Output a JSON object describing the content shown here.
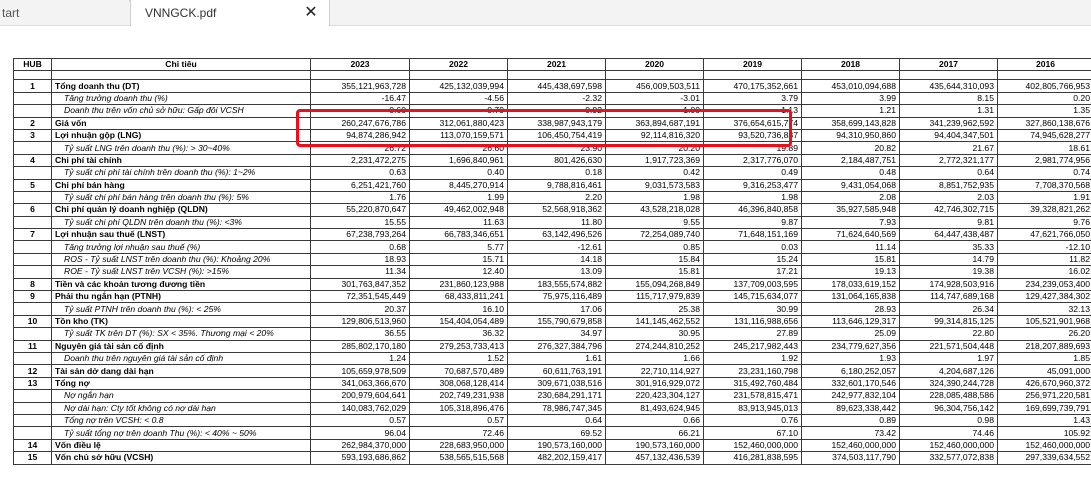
{
  "tabs": {
    "start_label": "tart",
    "file_label": "VNNGCK.pdf",
    "close_glyph": "✕"
  },
  "table": {
    "headers": [
      "HUB",
      "Chỉ tiêu",
      "2023",
      "2022",
      "2021",
      "2020",
      "2019",
      "2018",
      "2017",
      "2016"
    ],
    "rows": [
      {
        "hub": "1",
        "label": "Tổng doanh thu (DT)",
        "kind": "main",
        "values": [
          "355,121,963,728",
          "425,132,039,994",
          "445,438,697,598",
          "456,009,503,511",
          "470,175,352,661",
          "453,010,094,688",
          "435,644,310,093",
          "402,805,766,953"
        ]
      },
      {
        "hub": "",
        "label": "Tăng trưởng doanh thu (%)",
        "kind": "sub",
        "values": [
          "-16.47",
          "-4.56",
          "-2.32",
          "-3.01",
          "3.79",
          "3.99",
          "8.15",
          "0.20"
        ]
      },
      {
        "hub": "",
        "label": "Doanh thu trên vốn chủ sở hữu: Gấp đôi VCSH",
        "kind": "sub",
        "values": [
          "0.60",
          "0.79",
          "0.92",
          "1.00",
          "1.13",
          "1.21",
          "1.31",
          "1.35"
        ]
      },
      {
        "hub": "2",
        "label": "Giá vốn",
        "kind": "main",
        "values": [
          "260,247,676,786",
          "312,061,880,423",
          "338,987,943,179",
          "363,894,687,191",
          "376,654,615,774",
          "358,699,143,828",
          "341,239,962,592",
          "327,860,138,676"
        ]
      },
      {
        "hub": "3",
        "label": "Lợi nhuận gộp (LNG)",
        "kind": "main",
        "values": [
          "94,874,286,942",
          "113,070,159,571",
          "106,450,754,419",
          "92,114,816,320",
          "93,520,736,887",
          "94,310,950,860",
          "94,404,347,501",
          "74,945,628,277"
        ]
      },
      {
        "hub": "",
        "label": "Tỷ suất LNG trên doanh thu (%): > 30~40%",
        "kind": "sub",
        "values": [
          "26.72",
          "26.60",
          "23.90",
          "20.20",
          "19.89",
          "20.82",
          "21.67",
          "18.61"
        ]
      },
      {
        "hub": "4",
        "label": "Chi phí tài chính",
        "kind": "main",
        "values": [
          "2,231,472,275",
          "1,696,840,961",
          "801,426,630",
          "1,917,723,369",
          "2,317,776,070",
          "2,184,487,751",
          "2,772,321,177",
          "2,981,774,956"
        ]
      },
      {
        "hub": "",
        "label": "Tỷ suất chi phí tài chính trên doanh thu (%): 1~2%",
        "kind": "sub",
        "values": [
          "0.63",
          "0.40",
          "0.18",
          "0.42",
          "0.49",
          "0.48",
          "0.64",
          "0.74"
        ]
      },
      {
        "hub": "5",
        "label": "Chi phí bán hàng",
        "kind": "main",
        "values": [
          "6,251,421,760",
          "8,445,270,914",
          "9,788,816,461",
          "9,031,573,583",
          "9,316,253,477",
          "9,431,054,068",
          "8,851,752,935",
          "7,708,370,568"
        ]
      },
      {
        "hub": "",
        "label": "Tỷ suất chi phí bán hàng trên doanh thu (%): 5%",
        "kind": "sub",
        "values": [
          "1.76",
          "1.99",
          "2.20",
          "1.98",
          "1.98",
          "2.08",
          "2.03",
          "1.91"
        ]
      },
      {
        "hub": "6",
        "label": "Chi phí quản lý doanh nghiệp (QLDN)",
        "kind": "main",
        "values": [
          "55,220,870,647",
          "49,462,002,948",
          "52,568,918,362",
          "43,528,218,028",
          "46,396,840,858",
          "35,927,585,948",
          "42,746,302,715",
          "39,328,821,262"
        ]
      },
      {
        "hub": "",
        "label": "Tỷ suất chi phí QLDN trên doanh thu (%): <3%",
        "kind": "sub",
        "values": [
          "15.55",
          "11.63",
          "11.80",
          "9.55",
          "9.87",
          "7.93",
          "9.81",
          "9.76"
        ]
      },
      {
        "hub": "7",
        "label": "Lợi nhuận sau thuế (LNST)",
        "kind": "main",
        "values": [
          "67,238,793,264",
          "66,783,346,651",
          "63,142,496,526",
          "72,254,089,740",
          "71,648,151,169",
          "71,624,640,569",
          "64,447,438,487",
          "47,621,766,050"
        ]
      },
      {
        "hub": "",
        "label": "Tăng trưởng lợi nhuận sau thuế (%)",
        "kind": "sub",
        "values": [
          "0.68",
          "5.77",
          "-12.61",
          "0.85",
          "0.03",
          "11.14",
          "35.33",
          "-12.10"
        ]
      },
      {
        "hub": "",
        "label": "ROS - Tỷ suất LNST trên doanh thu (%): Khoảng 20%",
        "kind": "sub",
        "values": [
          "18.93",
          "15.71",
          "14.18",
          "15.84",
          "15.24",
          "15.81",
          "14.79",
          "11.82"
        ]
      },
      {
        "hub": "",
        "label": "ROE - Tỷ suất LNST trên VCSH (%): >15%",
        "kind": "sub",
        "values": [
          "11.34",
          "12.40",
          "13.09",
          "15.81",
          "17.21",
          "19.13",
          "19.38",
          "16.02"
        ]
      },
      {
        "hub": "8",
        "label": "Tiền và các khoản tương đương tiền",
        "kind": "main",
        "values": [
          "301,763,847,352",
          "231,860,123,988",
          "183,555,574,882",
          "155,094,268,849",
          "137,709,003,595",
          "178,033,619,152",
          "174,928,503,916",
          "234,239,053,400"
        ]
      },
      {
        "hub": "9",
        "label": "Phải thu ngắn hạn (PTNH)",
        "kind": "main",
        "values": [
          "72,351,545,449",
          "68,433,811,241",
          "75,975,116,489",
          "115,717,979,839",
          "145,715,634,077",
          "131,064,165,838",
          "114,747,689,168",
          "129,427,384,302"
        ]
      },
      {
        "hub": "",
        "label": "Tỷ suất PTNH trên doanh thu (%): < 25%",
        "kind": "sub",
        "values": [
          "20.37",
          "16.10",
          "17.06",
          "25.38",
          "30.99",
          "28.93",
          "26.34",
          "32.13"
        ]
      },
      {
        "hub": "10",
        "label": "Tồn kho (TK)",
        "kind": "main",
        "values": [
          "129,806,513,960",
          "154,404,054,489",
          "155,790,679,858",
          "141,145,462,552",
          "131,116,988,656",
          "113,646,129,317",
          "99,314,815,125",
          "105,521,901,968"
        ]
      },
      {
        "hub": "",
        "label": "Tỷ suất TK trên DT (%): SX < 35%. Thương mại < 20%",
        "kind": "sub",
        "values": [
          "36.55",
          "36.32",
          "34.97",
          "30.95",
          "27.89",
          "25.09",
          "22.80",
          "26.20"
        ]
      },
      {
        "hub": "11",
        "label": "Nguyên giá tài sản cố định",
        "kind": "main",
        "values": [
          "285,802,170,180",
          "279,253,733,413",
          "276,327,384,796",
          "274,244,810,252",
          "245,217,982,443",
          "234,779,627,356",
          "221,571,504,448",
          "218,207,889,693"
        ]
      },
      {
        "hub": "",
        "label": "Doanh thu trên nguyên giá tài sản cố định",
        "kind": "sub",
        "values": [
          "1.24",
          "1.52",
          "1.61",
          "1.66",
          "1.92",
          "1.93",
          "1.97",
          "1.85"
        ]
      },
      {
        "hub": "12",
        "label": "Tài sản dở dang dài hạn",
        "kind": "main",
        "values": [
          "105,659,978,509",
          "70,687,570,489",
          "60,611,763,191",
          "22,710,114,927",
          "23,231,160,798",
          "6,180,252,057",
          "4,204,687,126",
          "45,091,000"
        ]
      },
      {
        "hub": "13",
        "label": "Tổng nợ",
        "kind": "main",
        "values": [
          "341,063,366,670",
          "308,068,128,414",
          "309,671,038,516",
          "301,916,929,072",
          "315,492,760,484",
          "332,601,170,546",
          "324,390,244,728",
          "426,670,960,372"
        ]
      },
      {
        "hub": "",
        "label": "Nợ ngắn hạn",
        "kind": "sub",
        "values": [
          "200,979,604,641",
          "202,749,231,938",
          "230,684,291,171",
          "220,423,304,127",
          "231,578,815,471",
          "242,977,832,104",
          "228,085,488,586",
          "256,971,220,581"
        ]
      },
      {
        "hub": "",
        "label": "Nợ dài hạn: Cty tốt không có nợ dài hạn",
        "kind": "sub",
        "values": [
          "140,083,762,029",
          "105,318,896,476",
          "78,986,747,345",
          "81,493,624,945",
          "83,913,945,013",
          "89,623,338,442",
          "96,304,756,142",
          "169,699,739,791"
        ]
      },
      {
        "hub": "",
        "label": "Tổng nợ trên VCSH: < 0.8",
        "kind": "sub",
        "values": [
          "0.57",
          "0.57",
          "0.64",
          "0.66",
          "0.76",
          "0.89",
          "0.98",
          "1.43"
        ]
      },
      {
        "hub": "",
        "label": "Tỷ suất tổng nợ trên doanh Thu (%): < 40% ~ 50%",
        "kind": "sub",
        "values": [
          "96.04",
          "72.46",
          "69.52",
          "66.21",
          "67.10",
          "73.42",
          "74.46",
          "105.92"
        ]
      },
      {
        "hub": "14",
        "label": "Vốn điều lệ",
        "kind": "main",
        "values": [
          "262,984,370,000",
          "228,683,950,000",
          "190,573,160,000",
          "190,573,160,000",
          "152,460,000,000",
          "152,460,000,000",
          "152,460,000,000",
          "152,460,000,000"
        ]
      },
      {
        "hub": "15",
        "label": "Vốn chủ sở hữu (VCSH)",
        "kind": "main",
        "values": [
          "593,193,686,862",
          "538,565,515,568",
          "482,202,159,417",
          "457,132,436,539",
          "416,281,838,595",
          "374,503,117,790",
          "332,577,072,838",
          "297,339,634,552"
        ]
      }
    ]
  },
  "highlight_color": "#e8101a"
}
